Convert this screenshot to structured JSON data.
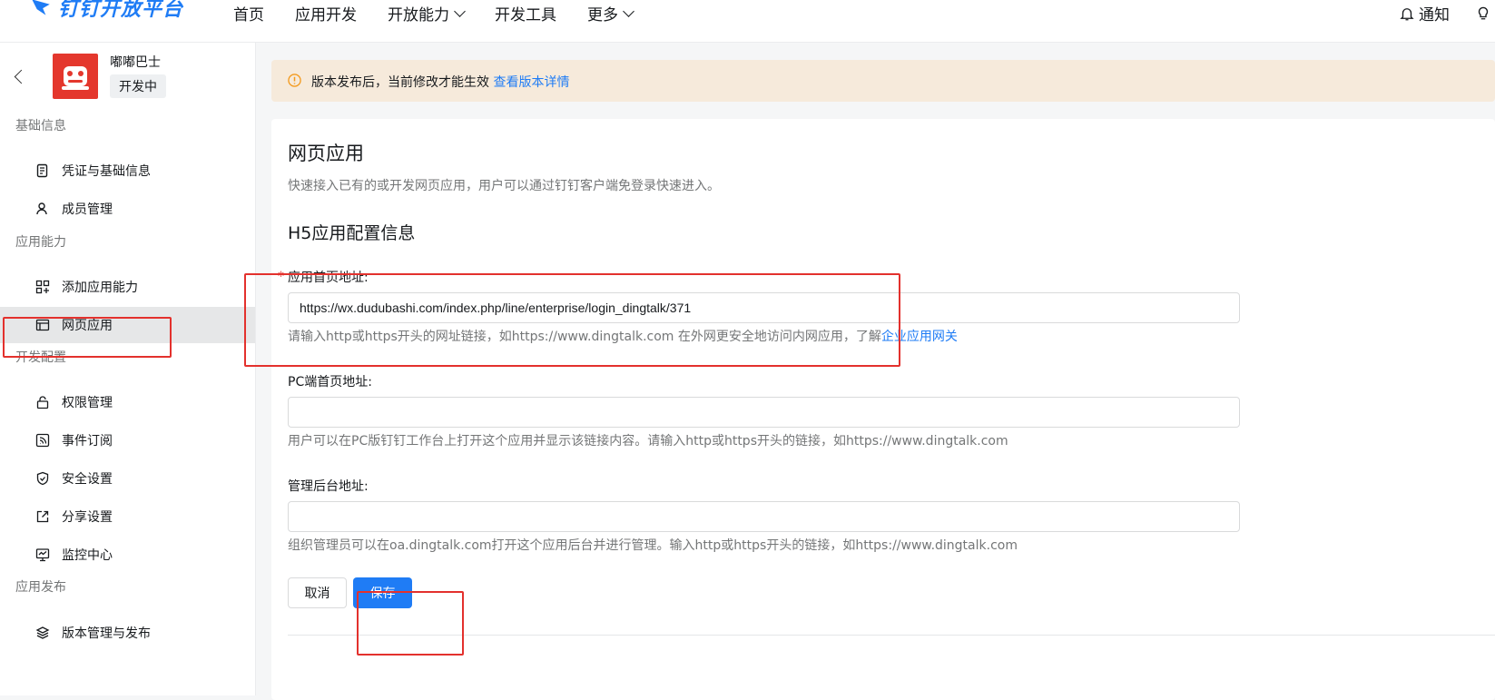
{
  "topbar": {
    "logo_text": "钉钉开放平台",
    "nav": [
      "首页",
      "应用开发",
      "开放能力",
      "开发工具",
      "更多"
    ],
    "notify": "通知"
  },
  "sidebar": {
    "app_name": "嘟嘟巴士",
    "app_status": "开发中",
    "sections": {
      "basic": "基础信息",
      "capability": "应用能力",
      "dev": "开发配置",
      "publish": "应用发布"
    },
    "items": {
      "credentials": "凭证与基础信息",
      "members": "成员管理",
      "add_capability": "添加应用能力",
      "webapp": "网页应用",
      "permissions": "权限管理",
      "events": "事件订阅",
      "security": "安全设置",
      "share": "分享设置",
      "monitor": "监控中心",
      "versions": "版本管理与发布"
    }
  },
  "banner": {
    "text": "版本发布后，当前修改才能生效",
    "link": "查看版本详情"
  },
  "form": {
    "title": "网页应用",
    "description": "快速接入已有的或开发网页应用，用户可以通过钉钉客户端免登录快速进入。",
    "section_title": "H5应用配置信息",
    "homepage": {
      "label": "应用首页地址:",
      "required_mark": "*",
      "value": "https://wx.dudubashi.com/index.php/line/enterprise/login_dingtalk/371",
      "hint": "请输入http或https开头的网址链接，如https://www.dingtalk.com 在外网更安全地访问内网应用，了解",
      "hint_link": "企业应用网关"
    },
    "pc_homepage": {
      "label": "PC端首页地址:",
      "value": "",
      "hint": "用户可以在PC版钉钉工作台上打开这个应用并显示该链接内容。请输入http或https开头的链接，如https://www.dingtalk.com"
    },
    "admin": {
      "label": "管理后台地址:",
      "value": "",
      "hint": "组织管理员可以在oa.dingtalk.com打开这个应用后台并进行管理。输入http或https开头的链接，如https://www.dingtalk.com"
    },
    "cancel_label": "取消",
    "save_label": "保存"
  },
  "colors": {
    "accent": "#1f7cf5",
    "annotation": "#e3312d",
    "banner_bg": "#f6eadb"
  }
}
